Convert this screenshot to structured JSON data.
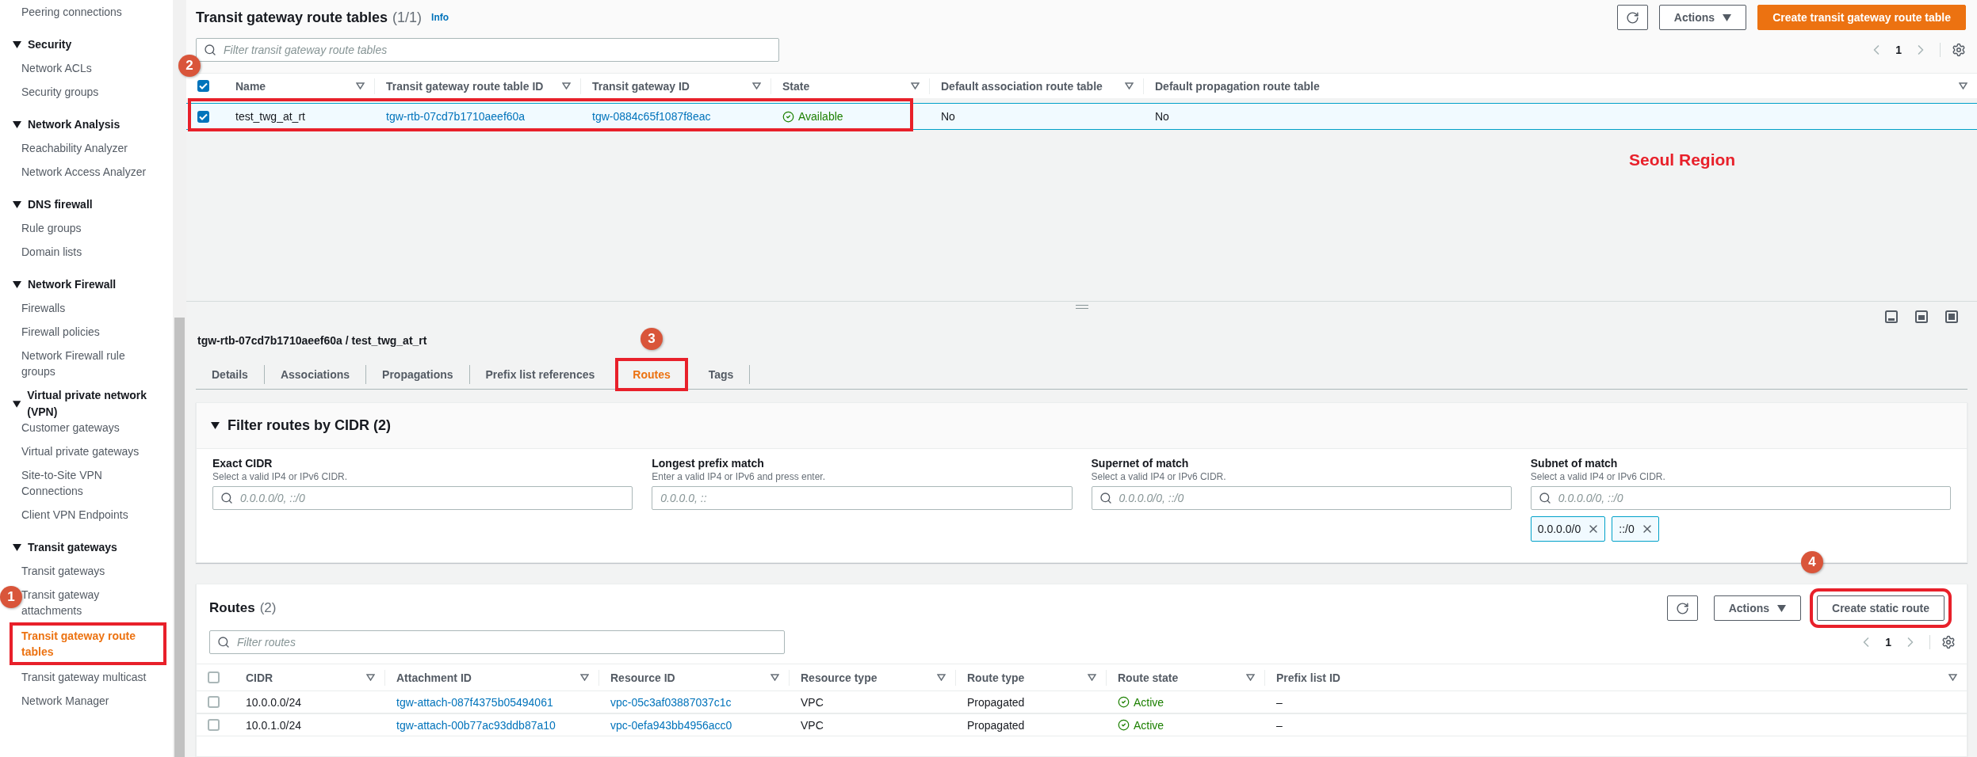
{
  "sidebar": {
    "cut_item": {
      "label": "Peering connections",
      "selected": false
    },
    "sections": [
      {
        "title": "Security",
        "expanded": true,
        "items": [
          {
            "label": "Network ACLs",
            "selected": false
          },
          {
            "label": "Security groups",
            "selected": false
          }
        ]
      },
      {
        "title": "Network Analysis",
        "expanded": true,
        "items": [
          {
            "label": "Reachability Analyzer",
            "selected": false
          },
          {
            "label": "Network Access Analyzer",
            "selected": false
          }
        ]
      },
      {
        "title": "DNS firewall",
        "expanded": true,
        "items": [
          {
            "label": "Rule groups",
            "selected": false
          },
          {
            "label": "Domain lists",
            "selected": false
          }
        ]
      },
      {
        "title": "Network Firewall",
        "expanded": true,
        "items": [
          {
            "label": "Firewalls",
            "selected": false
          },
          {
            "label": "Firewall policies",
            "selected": false
          },
          {
            "label": "Network Firewall rule groups",
            "selected": false
          }
        ]
      },
      {
        "title": "Virtual private network (VPN)",
        "expanded": true,
        "items": [
          {
            "label": "Customer gateways",
            "selected": false
          },
          {
            "label": "Virtual private gateways",
            "selected": false
          },
          {
            "label": "Site-to-Site VPN Connections",
            "selected": false
          },
          {
            "label": "Client VPN Endpoints",
            "selected": false
          }
        ]
      },
      {
        "title": "Transit gateways",
        "expanded": true,
        "items": [
          {
            "label": "Transit gateways",
            "selected": false
          },
          {
            "label": "Transit gateway attachments",
            "selected": false,
            "annotation": "1"
          },
          {
            "label": "Transit gateway route tables",
            "selected": true,
            "boxed": true
          },
          {
            "label": "Transit gateway multicast",
            "selected": false
          },
          {
            "label": "Network Manager",
            "selected": false
          }
        ]
      }
    ]
  },
  "route_tables": {
    "title": "Transit gateway route tables",
    "count": "(1/1)",
    "info": "Info",
    "filter_placeholder": "Filter transit gateway route tables",
    "actions": "Actions",
    "create": "Create transit gateway route table",
    "page": "1",
    "all_selected": true,
    "annotation": "2",
    "columns": [
      "Name",
      "Transit gateway route table ID",
      "Transit gateway ID",
      "State",
      "Default association route table",
      "Default propagation route table"
    ],
    "rows": [
      {
        "selected": true,
        "boxed": true,
        "name": "test_twg_at_rt",
        "route_table_id": "tgw-rtb-07cd7b1710aeef60a",
        "gateway_id": "tgw-0884c65f1087f8eac",
        "state": "Available",
        "default_association": "No",
        "default_propagation": "No"
      }
    ],
    "note": "Seoul Region"
  },
  "detail": {
    "title": "tgw-rtb-07cd7b1710aeef60a / test_twg_at_rt",
    "tabs": [
      {
        "label": "Details",
        "selected": false
      },
      {
        "label": "Associations",
        "selected": false
      },
      {
        "label": "Propagations",
        "selected": false
      },
      {
        "label": "Prefix list references",
        "selected": false
      },
      {
        "label": "Routes",
        "selected": true,
        "boxed": true,
        "annotation": "3"
      },
      {
        "label": "Tags",
        "selected": false
      }
    ],
    "filter": {
      "title": "Filter routes by CIDR (2)",
      "expanded": true,
      "fields": [
        {
          "label": "Exact CIDR",
          "description": "Select a valid IP4 or IPv6 CIDR.",
          "placeholder": "0.0.0.0/0, ::/0"
        },
        {
          "label": "Longest prefix match",
          "description": "Enter a valid IP4 or IPv6 and press enter.",
          "placeholder": "0.0.0.0, ::"
        },
        {
          "label": "Supernet of match",
          "description": "Select a valid IP4 or IPv6 CIDR.",
          "placeholder": "0.0.0.0/0, ::/0"
        },
        {
          "label": "Subnet of match",
          "description": "Select a valid IP4 or IPv6 CIDR.",
          "placeholder": "0.0.0.0/0, ::/0",
          "tokens": [
            "0.0.0.0/0",
            "::/0"
          ]
        }
      ]
    },
    "routes": {
      "title": "Routes",
      "count": "(2)",
      "filter_placeholder": "Filter routes",
      "actions": "Actions",
      "create": "Create static route",
      "create_boxed": true,
      "create_annotation": "4",
      "page": "1",
      "all_selected": false,
      "columns": [
        "CIDR",
        "Attachment ID",
        "Resource ID",
        "Resource type",
        "Route type",
        "Route state",
        "Prefix list ID"
      ],
      "rows": [
        {
          "selected": false,
          "cidr": "10.0.0.0/24",
          "attachment_id": "tgw-attach-087f4375b05494061",
          "resource_id": "vpc-05c3af03887037c1c",
          "resource_type": "VPC",
          "route_type": "Propagated",
          "state": "Active",
          "prefix_list": "–"
        },
        {
          "selected": false,
          "cidr": "10.0.1.0/24",
          "attachment_id": "tgw-attach-00b77ac93ddb87a10",
          "resource_id": "vpc-0efa943bb4956acc0",
          "resource_type": "VPC",
          "route_type": "Propagated",
          "state": "Active",
          "prefix_list": "–"
        }
      ]
    }
  }
}
